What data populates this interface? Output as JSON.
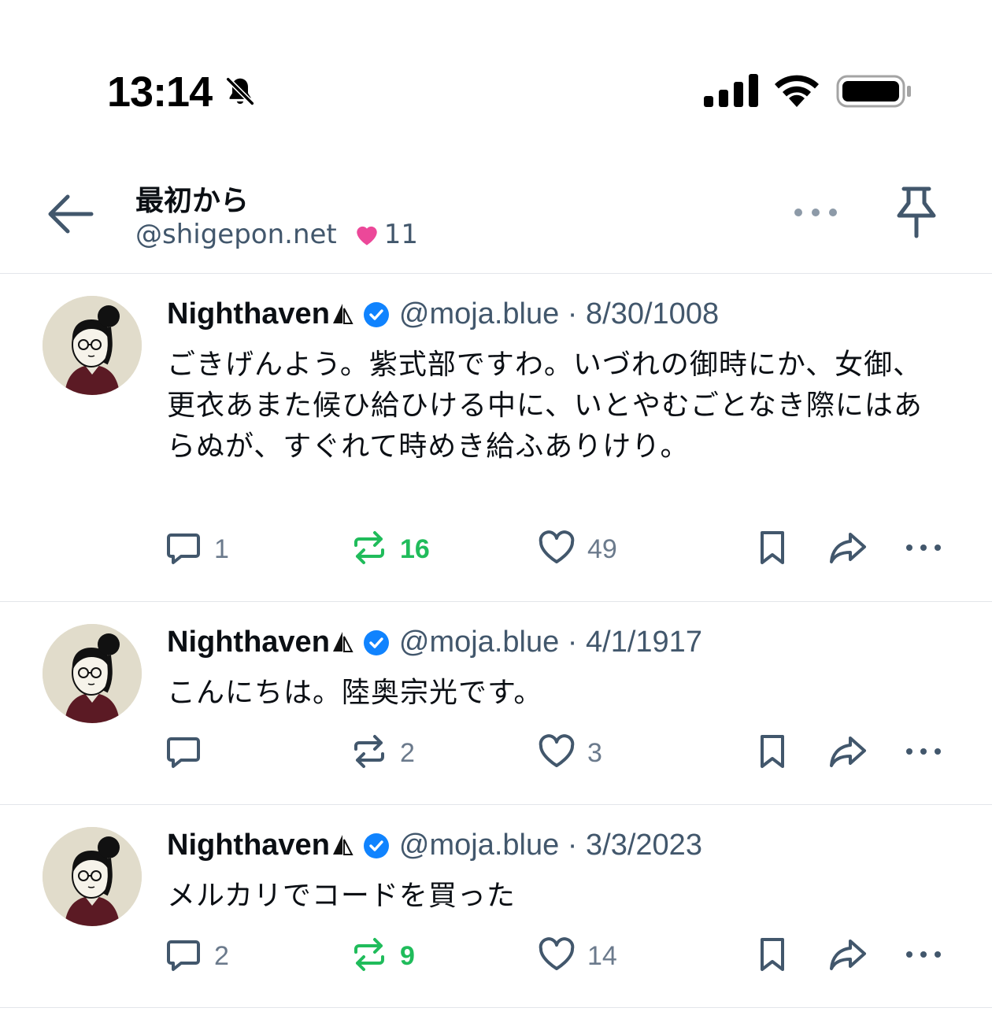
{
  "status_bar": {
    "time": "13:14"
  },
  "header": {
    "title": "最初から",
    "handle": "@shigepon.net",
    "likes": "11"
  },
  "posts": [
    {
      "name": "Nighthaven",
      "handle": "@moja.blue",
      "date": "8/30/1008",
      "text": "ごきげんよう。紫式部ですわ。いづれの御時にか、女御、更衣あまた候ひ給ひける中に、いとやむごとなき際にはあらぬが、すぐれて時めき給ふありけり。",
      "replies": "1",
      "reposts": "16",
      "likes": "49",
      "reposted": true
    },
    {
      "name": "Nighthaven",
      "handle": "@moja.blue",
      "date": "4/1/1917",
      "text": "こんにちは。陸奥宗光です。",
      "replies": "",
      "reposts": "2",
      "likes": "3",
      "reposted": false
    },
    {
      "name": "Nighthaven",
      "handle": "@moja.blue",
      "date": "3/3/2023",
      "text": "メルカリでコードを買った",
      "replies": "2",
      "reposts": "9",
      "likes": "14",
      "reposted": true
    }
  ],
  "colors": {
    "accent_green": "#20bc5b",
    "verified_blue": "#1083fe",
    "heart_pink": "#ec4899",
    "icon_gray": "#42576c"
  }
}
